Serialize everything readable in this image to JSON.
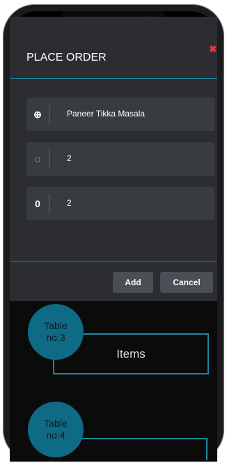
{
  "modal": {
    "title": "PLACE ORDER",
    "close_symbol": "✖",
    "fields": [
      {
        "icon": "plus-circle-icon",
        "glyph": "⊕",
        "value": "Paneer Tikka Masala"
      },
      {
        "icon": "refresh-icon",
        "glyph": "◌",
        "value": "2"
      },
      {
        "icon": "zero-icon",
        "glyph": "0",
        "value": "2"
      }
    ],
    "buttons": {
      "add": "Add",
      "cancel": "Cancel"
    }
  },
  "tables": [
    {
      "label": "Table no:3",
      "items_label": "Items"
    },
    {
      "label": "Table no:4"
    }
  ],
  "colors": {
    "accent": "#1a8aa0",
    "close": "#e53935",
    "panel": "#2b2d30",
    "field": "#383b40"
  }
}
